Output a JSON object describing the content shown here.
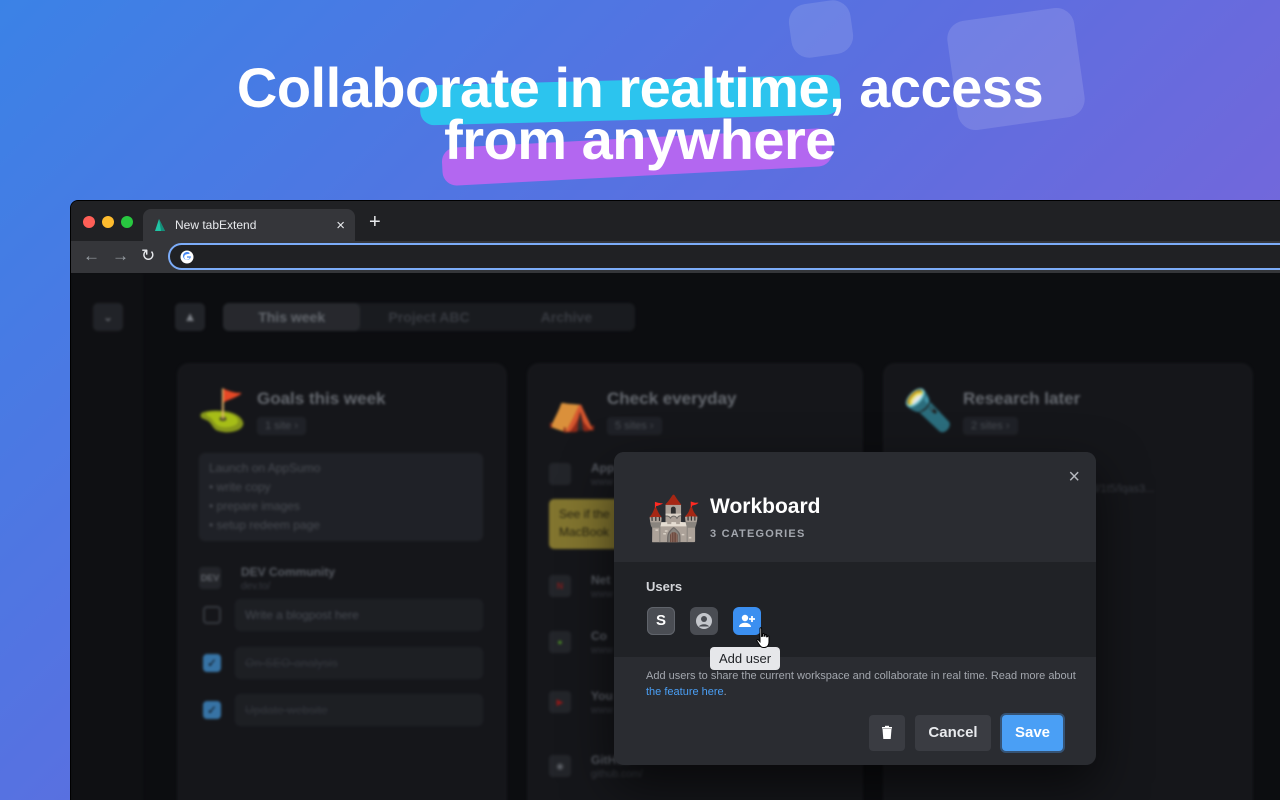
{
  "headline": {
    "line1": "Collaborate in realtime, access",
    "line2": "from anywhere"
  },
  "browser": {
    "tab_title": "New tabExtend",
    "tab_close": "×",
    "new_tab": "+",
    "nav": {
      "back": "←",
      "forward": "→",
      "reload": "↻"
    }
  },
  "app": {
    "tabs": [
      "This week",
      "Project ABC",
      "Archive"
    ],
    "cards": [
      {
        "emoji": "⛳",
        "title": "Goals this week",
        "count": "1 site ›",
        "note": [
          "Launch on AppSumo",
          "• write copy",
          "• prepare images",
          "• setup redeem page"
        ],
        "site": {
          "icon": "DEV",
          "name": "DEV Community",
          "url": "dev.to/"
        },
        "todos": [
          {
            "text": "Write a blogpost here",
            "checked": false
          },
          {
            "text": "On-SEO-analysis",
            "checked": true
          },
          {
            "text": "Update website",
            "checked": true
          }
        ]
      },
      {
        "emoji": "⛺",
        "title": "Check everyday",
        "count": "5 sites ›",
        "yellow_note": "See if the MacBook",
        "sites": [
          {
            "icon": "",
            "name": "App",
            "url": "www"
          },
          {
            "icon": "N",
            "name": "Net",
            "url": "www"
          },
          {
            "icon": "●",
            "name": "Co",
            "url": "www"
          },
          {
            "icon": "▶",
            "name": "You",
            "url": "www"
          },
          {
            "icon": "◉",
            "name": "GitHub",
            "url": "github.com/"
          }
        ]
      },
      {
        "emoji": "🔦",
        "title": "Research later",
        "count": "2 sites ›",
        "url_fragment": "om/d/1t5/lqas3..."
      }
    ]
  },
  "modal": {
    "close": "×",
    "emoji": "🏰",
    "title": "Workboard",
    "subtitle": "3 CATEGORIES",
    "users_label": "Users",
    "user_initial": "S",
    "tooltip": "Add user",
    "desc_text": "Add users to share the current workspace and collaborate in real time. Read more about ",
    "desc_link": "the feature here",
    "desc_end": ".",
    "cancel": "Cancel",
    "save": "Save"
  },
  "colors": {
    "accent": "#4a9ff5",
    "highlight_cyan": "#2cc4ee",
    "highlight_purple": "#b367f0"
  }
}
